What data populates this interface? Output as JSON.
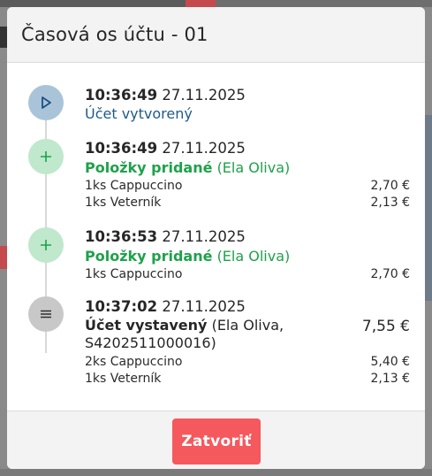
{
  "modal": {
    "title": "Časová os účtu - 01",
    "close_label": "Zatvoriť"
  },
  "events": [
    {
      "icon": "play-icon",
      "time": "10:36:49",
      "date": "27.11.2025",
      "title": "Účet vytvorený"
    },
    {
      "icon": "plus-icon",
      "time": "10:36:49",
      "date": "27.11.2025",
      "title": "Položky pridané",
      "user": "(Ela Oliva)",
      "items": [
        {
          "name": "1ks Cappuccino",
          "price": "2,70 €"
        },
        {
          "name": "1ks Veterník",
          "price": "2,13 €"
        }
      ]
    },
    {
      "icon": "plus-icon",
      "time": "10:36:53",
      "date": "27.11.2025",
      "title": "Položky pridané",
      "user": "(Ela Oliva)",
      "items": [
        {
          "name": "1ks Cappuccino",
          "price": "2,70 €"
        }
      ]
    },
    {
      "icon": "menu-icon",
      "time": "10:37:02",
      "date": "27.11.2025",
      "title": "Účet vystavený",
      "user_line1": "(Ela Oliva,",
      "user_line2": "S4202511000016)",
      "total": "7,55 €",
      "items": [
        {
          "name": "2ks Cappuccino",
          "price": "5,40 €"
        },
        {
          "name": "1ks Veterník",
          "price": "2,13 €"
        }
      ]
    }
  ],
  "colors": {
    "created": "#1f5b8a",
    "added": "#1fa14b",
    "close_button": "#f5585d"
  }
}
